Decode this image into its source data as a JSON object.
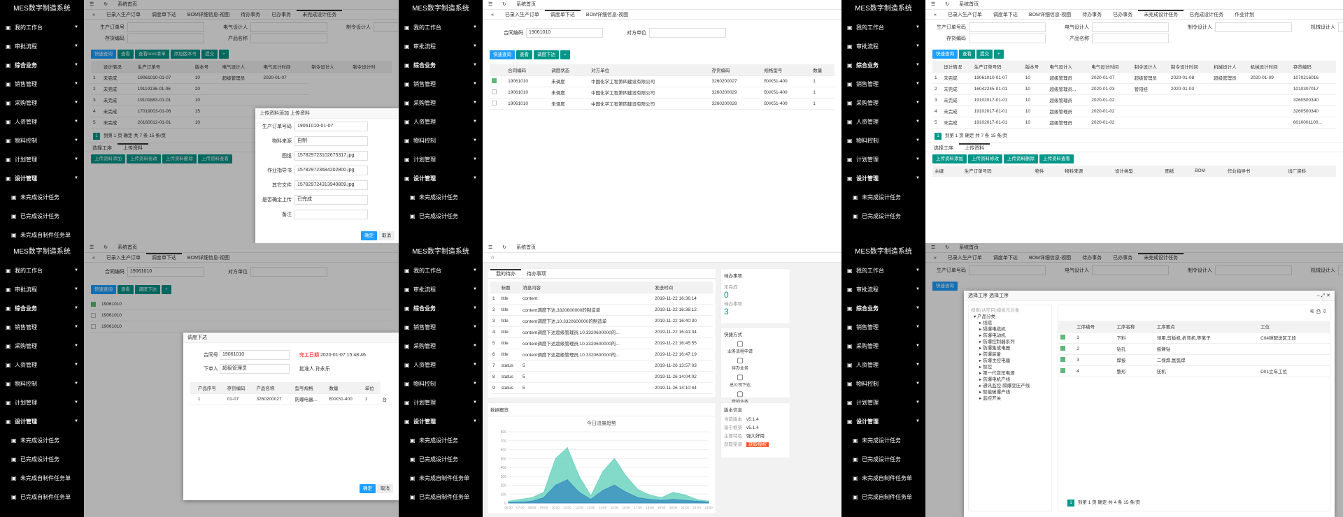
{
  "app": {
    "title": "MES数字制造系统",
    "home": "系统首页"
  },
  "sidebar": [
    "我的工作台",
    "审批流程",
    "综合业务",
    "销售管理",
    "采购管理",
    "人资管理",
    "物料控制",
    "计划管理",
    "设计管理",
    "未完成设计任务",
    "已完成设计任务",
    "未完成自制件任务单",
    "已完成自制件任务单"
  ],
  "tabs": [
    "已录入生产订单",
    "调度单下达",
    "BOM详细信息-视图",
    "待办事务",
    "已办事务",
    "未完成设计任务",
    "已完成设计任务",
    "作业计划"
  ],
  "p1": {
    "form": [
      {
        "l": "生产订单号",
        "v": ""
      },
      {
        "l": "电气设计人",
        "v": ""
      },
      {
        "l": "制令设计人",
        "v": ""
      },
      {
        "l": "存货编码",
        "v": ""
      },
      {
        "l": "产品名称",
        "v": ""
      }
    ],
    "buttons": [
      "快速查询",
      "查看",
      "查看bom清单",
      "添加版本号",
      "提交"
    ],
    "headers": [
      "",
      "设计情况",
      "生产订单号",
      "版本号",
      "电气设计人",
      "电气设计时间",
      "制令设计人",
      "制令设计时"
    ],
    "rows": [
      [
        "1",
        "未完成",
        "19061010-01-07",
        "10",
        "超级管理员",
        "2020-01-07"
      ],
      [
        "2",
        "未完成",
        "19119136-01-06",
        "20",
        "",
        ""
      ],
      [
        "3",
        "未完成",
        "19101883-01-01",
        "10",
        "",
        ""
      ],
      [
        "4",
        "未完成",
        "17019003-01-06",
        "15",
        "",
        ""
      ],
      [
        "5",
        "未完成",
        "20160012-01-01",
        "10",
        "",
        ""
      ]
    ],
    "subtabs": [
      "选择工序",
      "上传资料"
    ],
    "subbtns": [
      "上传资料添加",
      "上传资料修改",
      "上传资料删除",
      "上传资料查看"
    ],
    "dialog": {
      "title": "上传资料添加 上传资料",
      "fields": [
        {
          "l": "生产订单号码",
          "v": "19061010-01-07"
        },
        {
          "l": "物料来源",
          "v": "自制"
        },
        {
          "l": "图纸",
          "v": "1578297231026753​17.jpg"
        },
        {
          "l": "作业指导书",
          "v": "157829723684202800.jpg"
        },
        {
          "l": "其它文件",
          "v": "157829724313940809.jpg"
        },
        {
          "l": "是否确定上传",
          "v": "已完成"
        },
        {
          "l": "备注",
          "v": ""
        }
      ],
      "ok": "确定",
      "cancel": "取消"
    },
    "pager": {
      "page": "1",
      "goto": "到第",
      "unit": "页",
      "confirm": "确定",
      "total": "共 7 条",
      "size": "15 条/页"
    }
  },
  "p2": {
    "form": [
      {
        "l": "合同编码",
        "v": "19061010"
      },
      {
        "l": "对方单位",
        "v": ""
      }
    ],
    "buttons": [
      "快速查询",
      "查看",
      "调度下达"
    ],
    "headers": [
      "",
      "合同编码",
      "调度状态",
      "对方单位",
      "存货编码",
      "规格型号",
      "数量"
    ],
    "rows": [
      [
        "19061010",
        "未调度",
        "中国化学工程第四建设有限公司",
        "3260200027",
        "BXK51-400",
        "1"
      ],
      [
        "19061010",
        "未调度",
        "中国化学工程第四建设有限公司",
        "3260200029",
        "BXK51-400",
        "1"
      ],
      [
        "19061010",
        "未调度",
        "中国化学工程第四建设有限公司",
        "3260200028",
        "BXK51-400",
        "1"
      ]
    ]
  },
  "p3": {
    "form": [
      {
        "l": "生产订单号码",
        "v": ""
      },
      {
        "l": "电气设计人",
        "v": ""
      },
      {
        "l": "制令设计人",
        "v": ""
      },
      {
        "l": "机械设计人",
        "v": ""
      },
      {
        "l": "存货编码",
        "v": ""
      },
      {
        "l": "产品名称",
        "v": ""
      }
    ],
    "buttons": [
      "快速查询",
      "查看",
      "提交"
    ],
    "headers": [
      "",
      "设计情况",
      "生产订单号码",
      "版本号",
      "电气设计人",
      "电气设计时间",
      "制令设计人",
      "制令设计时间",
      "机械设计人",
      "机械设计时间",
      "存货编码"
    ],
    "rows": [
      [
        "1",
        "未完成",
        "19061010-01-07",
        "10",
        "超级管理员",
        "2020-01-07",
        "超级管理员",
        "2020-01-08",
        "超级管理员",
        "2020-01-09",
        "1070216016"
      ],
      [
        "2",
        "未完成",
        "16042245-01-01",
        "10",
        "超级管理员...",
        "2020-01-03",
        "管阳经",
        "2020-01-03",
        "",
        "",
        "1010307017"
      ],
      [
        "3",
        "未完成",
        "19102017-01-01",
        "10",
        "超级管理员",
        "2020-01-02",
        "",
        "",
        "",
        "",
        "3260500340"
      ],
      [
        "4",
        "未完成",
        "19102017-01-01",
        "10",
        "超级管理员",
        "2020-01-02",
        "",
        "",
        "",
        "",
        "3260500340"
      ],
      [
        "5",
        "未完成",
        "19102017-01-01",
        "10",
        "超级管理员",
        "2020-01-02",
        "",
        "",
        "",
        "",
        "6010001100..."
      ]
    ],
    "subtabs": [
      "选择工序",
      "上传资料"
    ],
    "subbtns": [
      "上传资料添加",
      "上传资料修改",
      "上传资料删除",
      "上传资料查看"
    ],
    "subheaders": [
      "主键",
      "生产订单号码",
      "物件",
      "物料来源",
      "设计类型",
      "图纸",
      "BOM",
      "作业指导书",
      "出厂资料"
    ],
    "pager": {
      "page": "1",
      "goto": "到第",
      "unit": "页",
      "confirm": "确定",
      "total": "共 7 条",
      "size": "15 条/页"
    }
  },
  "p4": {
    "form": [
      {
        "l": "合同编码",
        "v": "19061010"
      },
      {
        "l": "对方单位",
        "v": ""
      }
    ],
    "buttons": [
      "快速查询",
      "查看",
      "调度下达"
    ],
    "rows": [
      "19061010",
      "19061010",
      "19061010"
    ],
    "dialog": {
      "title": "调度下达",
      "contract_l": "合同号",
      "contract": "19061010",
      "date_l": "完工日期",
      "date": "2020-01-07 15:48:46",
      "issuer_l": "下单人",
      "issuer": "超级管理员",
      "recv_l": "批准人",
      "recv": "孙永乐",
      "headers": [
        "",
        "产品序号",
        "存货编码",
        "产品名称",
        "型号规格",
        "数量",
        "单位"
      ],
      "row": [
        "1",
        "01-07",
        "3260200027",
        "防爆电器...",
        "BXK51-400",
        "1",
        "台"
      ],
      "ok": "确定",
      "cancel": "取消"
    }
  },
  "p5": {
    "tabs": [
      "我的待办",
      "待办事项"
    ],
    "headers": [
      "",
      "标题",
      "消息内容",
      "发送时间"
    ],
    "rows": [
      [
        "1",
        "title",
        "content",
        "2019-11-22 16:36:14"
      ],
      [
        "2",
        "title",
        "content调度下达,3320600000的制造单",
        "2019-11-22 16:36:12"
      ],
      [
        "3",
        "title",
        "content调度下达,10.3320600000的制造单",
        "2019-11-22 16:40:30"
      ],
      [
        "4",
        "title",
        "content调度下达超级管理员,10.3320600000的...",
        "2019-11-22 16:41:34"
      ],
      [
        "5",
        "title",
        "content调度下达超级管理员,10.3320600000的...",
        "2019-11-22 16:45:55"
      ],
      [
        "6",
        "title",
        "content调度下达超级管理员,10.3320600000的...",
        "2019-11-22 16:47:19"
      ],
      [
        "7",
        "status",
        "5",
        "2019-11-26 13:57:03"
      ],
      [
        "8",
        "status",
        "5",
        "2019-11-26 14:04:02"
      ],
      [
        "9",
        "status",
        "5",
        "2019-11-26 14:10:44"
      ]
    ],
    "todo": {
      "title": "待办事项",
      "a_l": "未完成",
      "a": "0",
      "b_l": "待办事项",
      "b": "3"
    },
    "quick": {
      "title": "快捷方式",
      "items": [
        "业务流程申请",
        "待办业务",
        "总公司下达",
        "我的业务",
        "员工管理",
        "本单管理"
      ]
    },
    "info": {
      "title": "版本信息",
      "rows": [
        [
          "当前版本",
          "v5.1.4"
        ],
        [
          "基于框架",
          "v5.1.4"
        ],
        [
          "主要特色",
          "强大好用"
        ],
        [
          "获取渠道",
          "获取授权"
        ]
      ]
    },
    "chart_title": "数据概览",
    "chart_data": {
      "type": "area",
      "title": "今日流量趋势",
      "categories": [
        "06:00",
        "07:00",
        "08:00",
        "09:00",
        "10:00",
        "11:00",
        "12:00",
        "13:00",
        "14:00",
        "15:00",
        "16:00",
        "17:00",
        "18:00",
        "19:00",
        "20:00",
        "21:00",
        "22:00",
        "23:00"
      ],
      "ylim": [
        0,
        800
      ],
      "yticks": [
        "0",
        "100",
        "200",
        "300",
        "400",
        "500",
        "600",
        "700",
        "800"
      ],
      "series": [
        {
          "values": [
            20,
            40,
            60,
            120,
            500,
            620,
            300,
            80,
            350,
            500,
            300,
            150,
            90,
            60,
            120,
            90,
            40,
            20
          ]
        },
        {
          "values": [
            5,
            10,
            20,
            60,
            200,
            260,
            120,
            40,
            140,
            200,
            120,
            60,
            40,
            30,
            40,
            30,
            20,
            10
          ]
        }
      ],
      "colors": [
        "#6fd3c0",
        "#3a8fbf"
      ]
    }
  },
  "p6": {
    "form": [
      {
        "l": "生产订单号码",
        "v": ""
      },
      {
        "l": "电气设计人",
        "v": ""
      },
      {
        "l": "制令设计人",
        "v": ""
      },
      {
        "l": "机械设计人",
        "v": ""
      }
    ],
    "buttons": [
      "快速查询"
    ],
    "dialog": {
      "title": "选择工序 选择工序",
      "search": "搜索(从项目)模板元对象",
      "tree": [
        "产品分类",
        "线缆",
        "隔爆电缆机",
        "防爆电动机",
        "防爆控制器系列",
        "防爆集成电器",
        "防爆装备",
        "防爆主控电器",
        "智控",
        "第一代变压电源",
        "防爆电机产线",
        "通讯监控-隔爆变压产线",
        "智能破爆产线",
        "监控开关"
      ],
      "headers": [
        "",
        "工序编号",
        "工序名称",
        "工序要点",
        "工位"
      ],
      "rows": [
        [
          "1",
          "下料",
          "领用,剪板机,折弯机,等离子",
          "C04弹配送区工段"
        ],
        [
          "2",
          "钻孔",
          "摇臂钻",
          ""
        ],
        [
          "3",
          "焊接",
          "二保焊,氩弧焊",
          ""
        ],
        [
          "4",
          "整形",
          "压机",
          "D01立车工位"
        ]
      ],
      "pager": {
        "page": "1",
        "goto": "到第",
        "unit": "页",
        "confirm": "确定",
        "total": "共 4 条",
        "size": "15 条/页"
      }
    }
  }
}
